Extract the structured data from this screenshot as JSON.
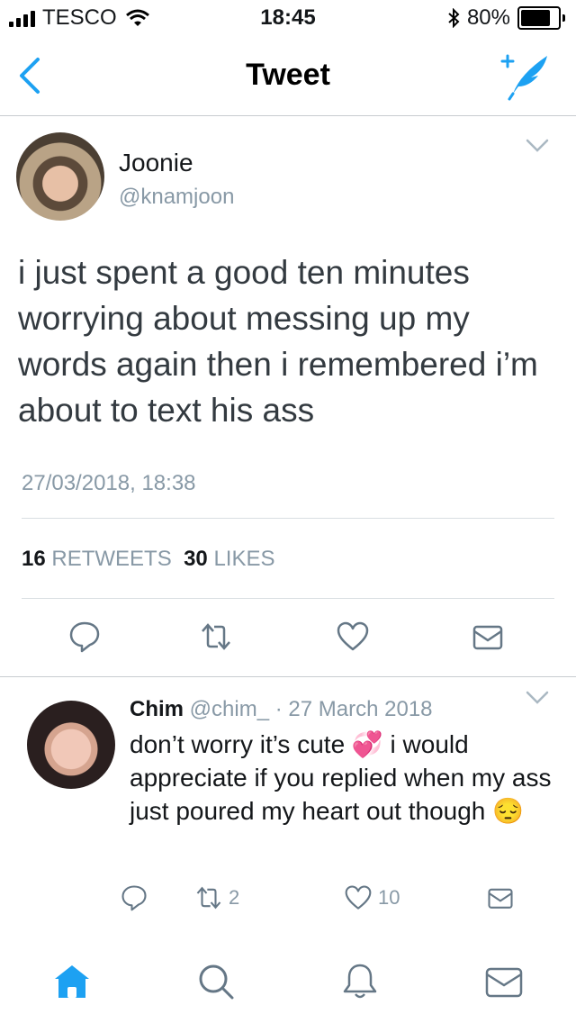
{
  "status_bar": {
    "carrier": "TESCO",
    "time": "18:45",
    "battery": "80%",
    "battery_level": 0.8
  },
  "nav": {
    "title": "Tweet",
    "back_icon": "chevron-left-icon",
    "compose_icon": "compose-tweet-icon"
  },
  "tweet": {
    "display_name": "Joonie",
    "handle": "@knamjoon",
    "text": "i just spent a good ten minutes worrying about messing up my words again then i remembered i’m about to text his ass",
    "timestamp": "27/03/2018, 18:38",
    "retweets_count": "16",
    "retweets_label": "RETWEETS",
    "likes_count": "30",
    "likes_label": "LIKES"
  },
  "reply": {
    "display_name": "Chim",
    "handle": "@chim_",
    "separator": "·",
    "date": "27 March 2018",
    "text": "don’t worry it’s cute 💞 i would appreciate if you replied when my ass just poured my heart out though 😔",
    "retweet_count": "2",
    "like_count": "10"
  },
  "colors": {
    "accent": "#1da1f2",
    "muted": "#8899a6",
    "text": "#14171a"
  }
}
